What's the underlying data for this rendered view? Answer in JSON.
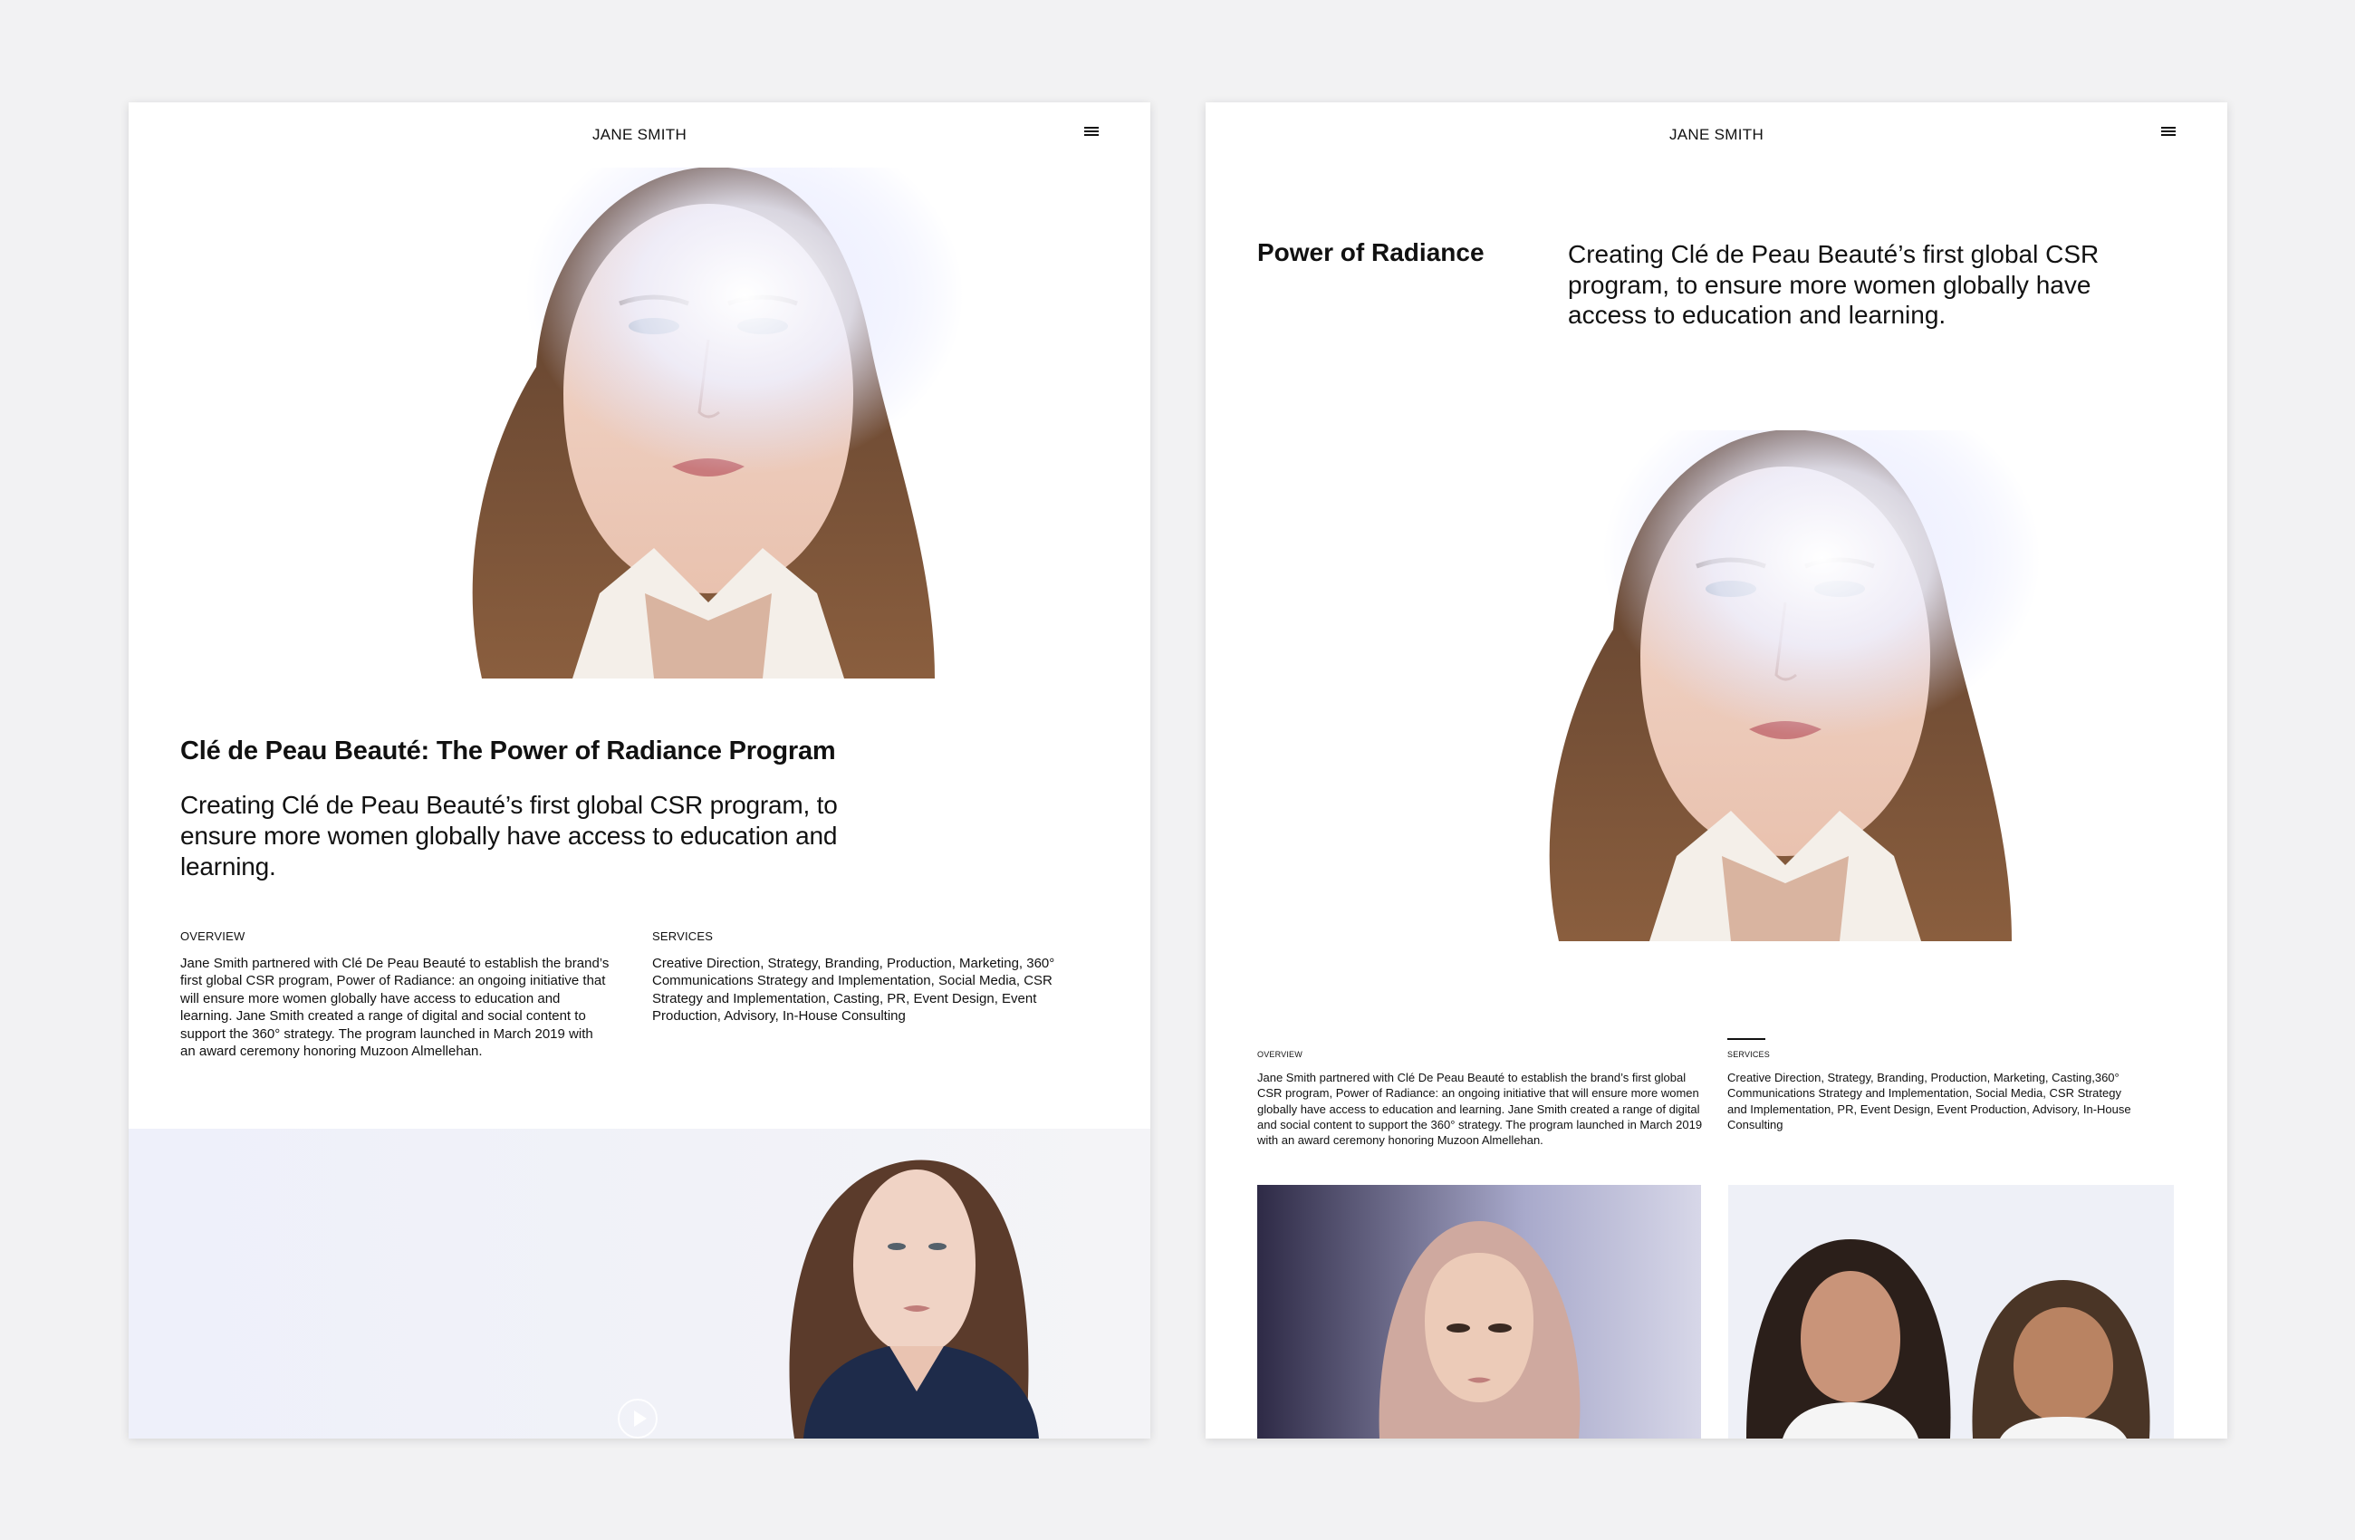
{
  "left_page": {
    "header": {
      "brand": "JANE SMITH",
      "menu_icon": "hamburger-menu-icon"
    },
    "hero_image": {
      "subject": "woman portrait"
    },
    "title": "Clé de Peau Beauté: The Power of Radiance Program",
    "lede": "Creating Clé de Peau Beauté’s first global CSR program, to ensure more women globally have access to education and learning.",
    "overview": {
      "label": "OVERVIEW",
      "text": "Jane Smith partnered with Clé De Peau Beauté to establish the brand’s first global CSR program, Power of Radiance: an ongoing initiative that will ensure more women globally have access to education and learning. Jane Smith created a range of digital and social content to support the 360° strategy. The program launched in March 2019 with an award ceremony honoring Muzoon Almellehan."
    },
    "services": {
      "label": "SERVICES",
      "text": "Creative Direction, Strategy, Branding, Production, Marketing, 360° Communications Strategy and Implementation, Social Media, CSR Strategy and Implementation, Casting, PR, Event Design, Event Production, Advisory, In-House Consulting"
    },
    "video": {
      "play_icon": "play-icon"
    }
  },
  "right_page": {
    "header": {
      "brand": "JANE SMITH",
      "menu_icon": "hamburger-menu-icon"
    },
    "section_title": "Power of Radiance",
    "section_lede": "Creating Clé de Peau Beauté’s first global CSR program, to ensure more women globally have access to education and learning.",
    "overview": {
      "label": "OVERVIEW",
      "text": "Jane Smith partnered with Clé De Peau Beauté to establish the brand’s first global CSR program, Power of Radiance: an ongoing initiative that will ensure more women globally have access to education and learning. Jane Smith created a range of digital and social content to support the 360° strategy. The program launched in March 2019 with an award ceremony honoring Muzoon Almellehan."
    },
    "services": {
      "label": "SERVICES",
      "text": "Creative Direction, Strategy, Branding, Production, Marketing, Casting,360° Communications Strategy and Implementation, Social Media, CSR Strategy and Implementation,  PR, Event Design, Event Production, Advisory, In-House Consulting"
    }
  },
  "colors": {
    "background": "#f2f2f3",
    "page": "#ffffff",
    "text": "#111111",
    "video_band": "#eef0fa"
  }
}
